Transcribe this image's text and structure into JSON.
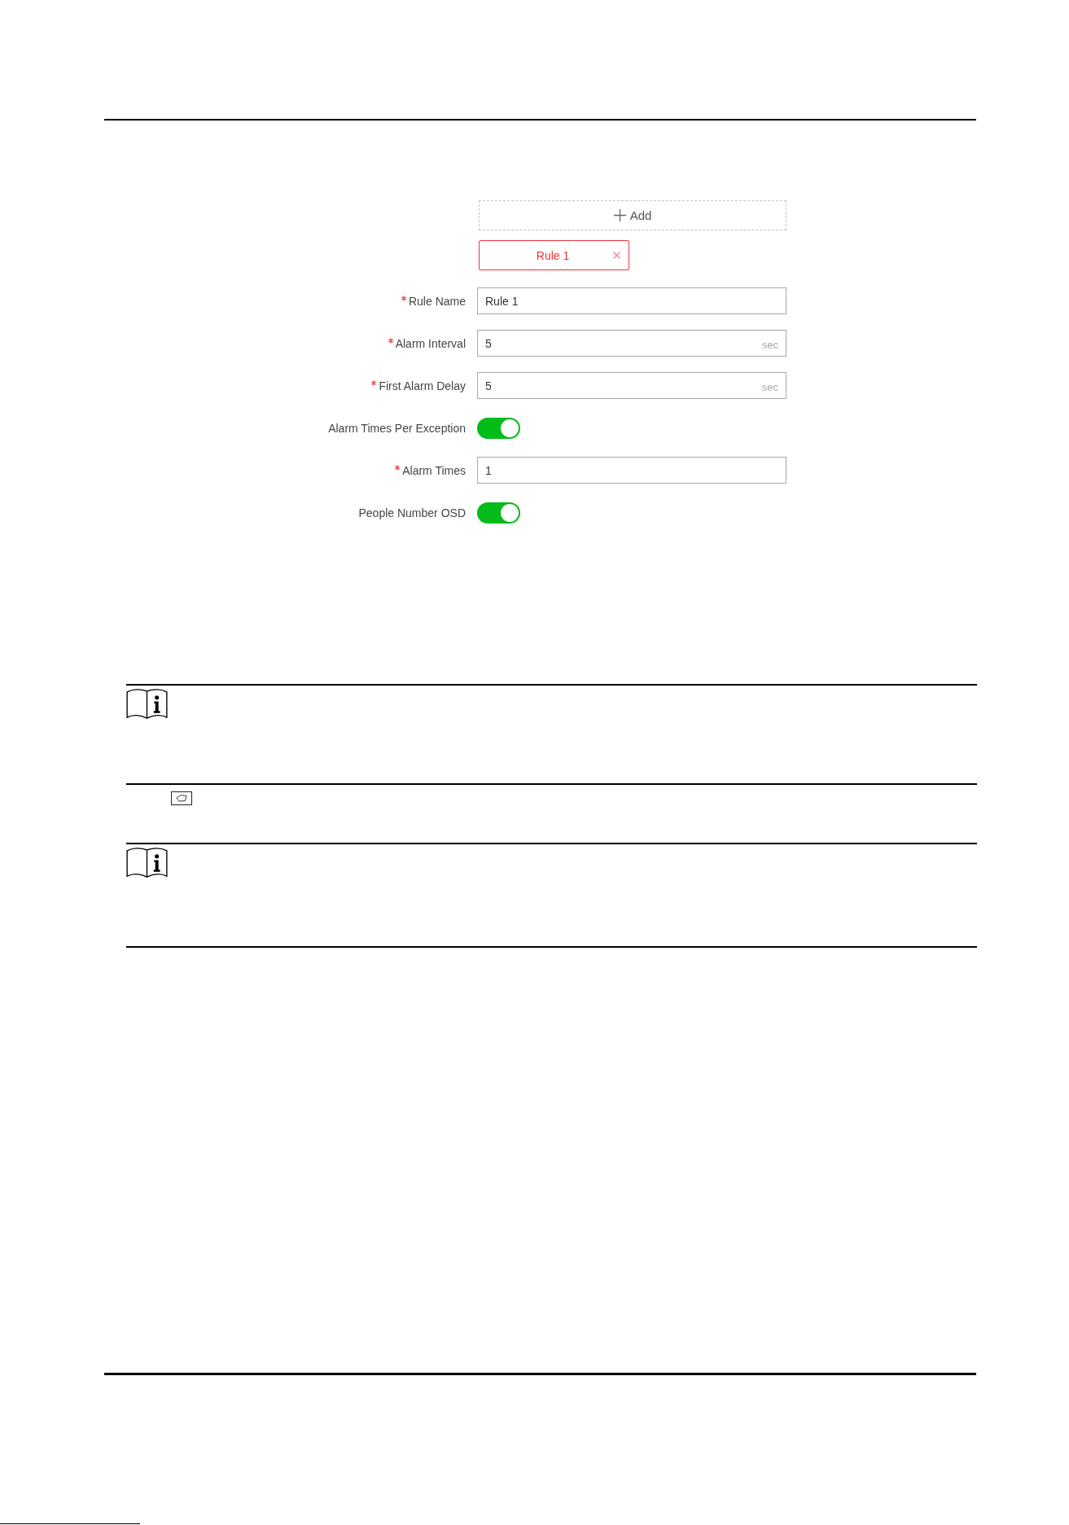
{
  "form": {
    "add_button": {
      "label": "Add"
    },
    "rules": [
      {
        "label": "Rule 1",
        "selected": true
      }
    ],
    "fields": [
      {
        "kind": "input",
        "label": "Rule Name",
        "required": true,
        "value": "Rule 1"
      },
      {
        "kind": "input",
        "label": "Alarm Interval",
        "required": true,
        "value": "5",
        "unit": "sec"
      },
      {
        "kind": "input",
        "label": "First Alarm Delay",
        "required": true,
        "value": "5",
        "unit": "sec"
      },
      {
        "kind": "toggle",
        "label": "Alarm Times Per Exception",
        "required": false,
        "on": true
      },
      {
        "kind": "input",
        "label": "Alarm Times",
        "required": true,
        "value": "1"
      },
      {
        "kind": "toggle",
        "label": "People Number OSD",
        "required": false,
        "on": true
      }
    ]
  }
}
